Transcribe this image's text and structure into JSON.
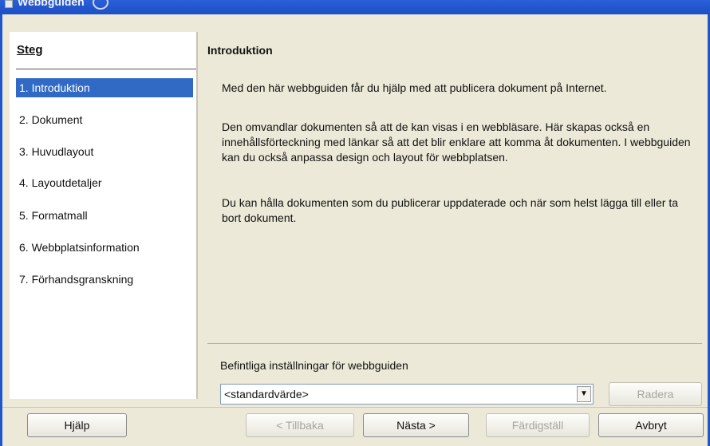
{
  "window": {
    "title": "Webbguiden"
  },
  "steps": {
    "heading": "Steg",
    "items": [
      {
        "label": "1. Introduktion",
        "active": true
      },
      {
        "label": "2. Dokument",
        "active": false
      },
      {
        "label": "3. Huvudlayout",
        "active": false
      },
      {
        "label": "4. Layoutdetaljer",
        "active": false
      },
      {
        "label": "5. Formatmall",
        "active": false
      },
      {
        "label": "6. Webbplatsinformation",
        "active": false
      },
      {
        "label": "7. Förhandsgranskning",
        "active": false
      }
    ]
  },
  "content": {
    "title": "Introduktion",
    "paragraphs": [
      "Med den här webbguiden får du hjälp med att publicera dokument på Internet.",
      "Den omvandlar dokumenten så att de kan visas i en webbläsare. Här skapas också en innehållsförteckning med länkar så att det blir enklare att komma åt dokumenten. I webbguiden kan du också anpassa design och layout för webbplatsen.",
      "Du kan hålla dokumenten som du publicerar uppdaterade och när som helst lägga till eller ta bort dokument."
    ],
    "settings_label": "Befintliga inställningar för webbguiden",
    "settings_value": "<standardvärde>",
    "delete_label": "Radera"
  },
  "buttons": {
    "help": "Hjälp",
    "back": "< Tillbaka",
    "next": "Nästa >",
    "finish": "Färdigställ",
    "cancel": "Avbryt"
  },
  "colors": {
    "selection": "#316ac5",
    "titlebar": "#1f56c9",
    "dialog_bg": "#ece9d8"
  }
}
